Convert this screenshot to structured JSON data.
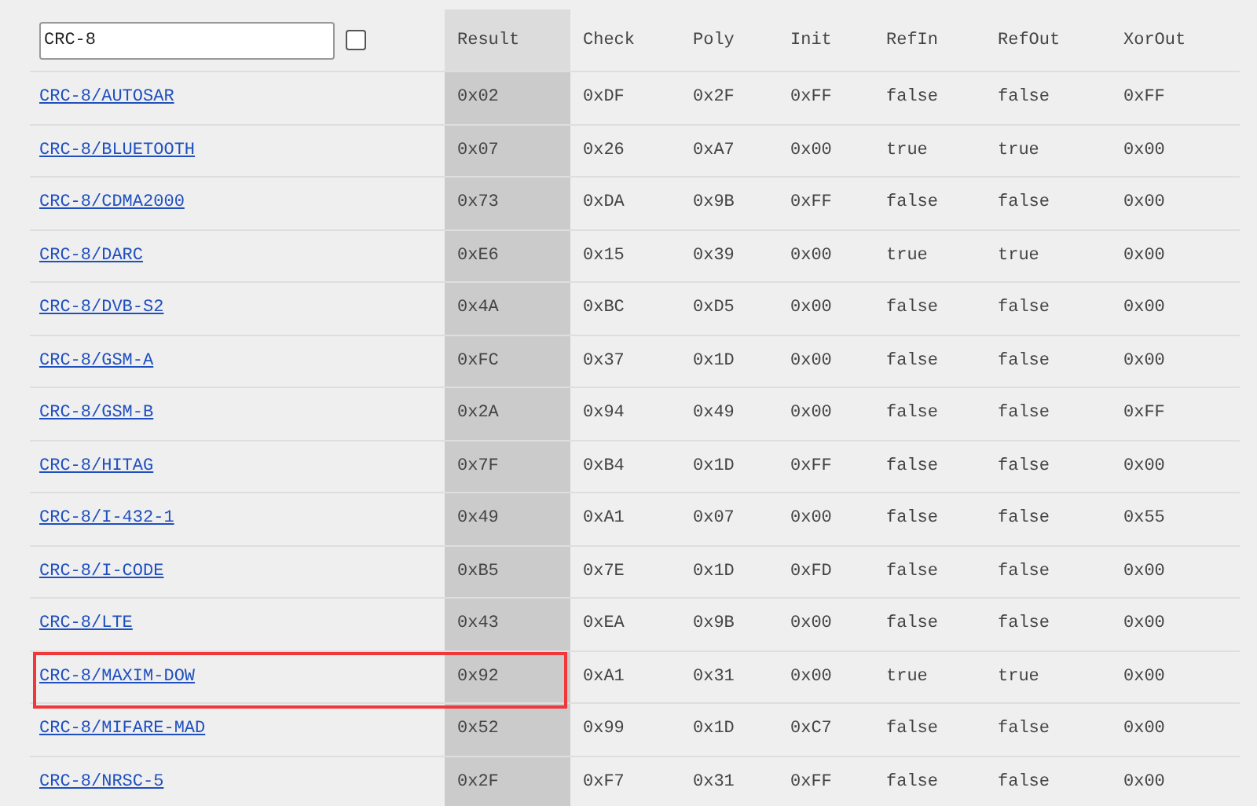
{
  "search": {
    "value": "CRC-8"
  },
  "filter_checkbox": {
    "checked": false
  },
  "columns": [
    "Result",
    "Check",
    "Poly",
    "Init",
    "RefIn",
    "RefOut",
    "XorOut"
  ],
  "rows": [
    {
      "name": "CRC-8/AUTOSAR",
      "cells": [
        "0x02",
        "0xDF",
        "0x2F",
        "0xFF",
        "false",
        "false",
        "0xFF"
      ],
      "highlighted": false
    },
    {
      "name": "CRC-8/BLUETOOTH",
      "cells": [
        "0x07",
        "0x26",
        "0xA7",
        "0x00",
        "true",
        "true",
        "0x00"
      ],
      "highlighted": false
    },
    {
      "name": "CRC-8/CDMA2000",
      "cells": [
        "0x73",
        "0xDA",
        "0x9B",
        "0xFF",
        "false",
        "false",
        "0x00"
      ],
      "highlighted": false
    },
    {
      "name": "CRC-8/DARC",
      "cells": [
        "0xE6",
        "0x15",
        "0x39",
        "0x00",
        "true",
        "true",
        "0x00"
      ],
      "highlighted": false
    },
    {
      "name": "CRC-8/DVB-S2",
      "cells": [
        "0x4A",
        "0xBC",
        "0xD5",
        "0x00",
        "false",
        "false",
        "0x00"
      ],
      "highlighted": false
    },
    {
      "name": "CRC-8/GSM-A",
      "cells": [
        "0xFC",
        "0x37",
        "0x1D",
        "0x00",
        "false",
        "false",
        "0x00"
      ],
      "highlighted": false
    },
    {
      "name": "CRC-8/GSM-B",
      "cells": [
        "0x2A",
        "0x94",
        "0x49",
        "0x00",
        "false",
        "false",
        "0xFF"
      ],
      "highlighted": false
    },
    {
      "name": "CRC-8/HITAG",
      "cells": [
        "0x7F",
        "0xB4",
        "0x1D",
        "0xFF",
        "false",
        "false",
        "0x00"
      ],
      "highlighted": false
    },
    {
      "name": "CRC-8/I-432-1",
      "cells": [
        "0x49",
        "0xA1",
        "0x07",
        "0x00",
        "false",
        "false",
        "0x55"
      ],
      "highlighted": false
    },
    {
      "name": "CRC-8/I-CODE",
      "cells": [
        "0xB5",
        "0x7E",
        "0x1D",
        "0xFD",
        "false",
        "false",
        "0x00"
      ],
      "highlighted": false
    },
    {
      "name": "CRC-8/LTE",
      "cells": [
        "0x43",
        "0xEA",
        "0x9B",
        "0x00",
        "false",
        "false",
        "0x00"
      ],
      "highlighted": false
    },
    {
      "name": "CRC-8/MAXIM-DOW",
      "cells": [
        "0x92",
        "0xA1",
        "0x31",
        "0x00",
        "true",
        "true",
        "0x00"
      ],
      "highlighted": true
    },
    {
      "name": "CRC-8/MIFARE-MAD",
      "cells": [
        "0x52",
        "0x99",
        "0x1D",
        "0xC7",
        "false",
        "false",
        "0x00"
      ],
      "highlighted": false
    },
    {
      "name": "CRC-8/NRSC-5",
      "cells": [
        "0x2F",
        "0xF7",
        "0x31",
        "0xFF",
        "false",
        "false",
        "0x00"
      ],
      "highlighted": false
    }
  ]
}
